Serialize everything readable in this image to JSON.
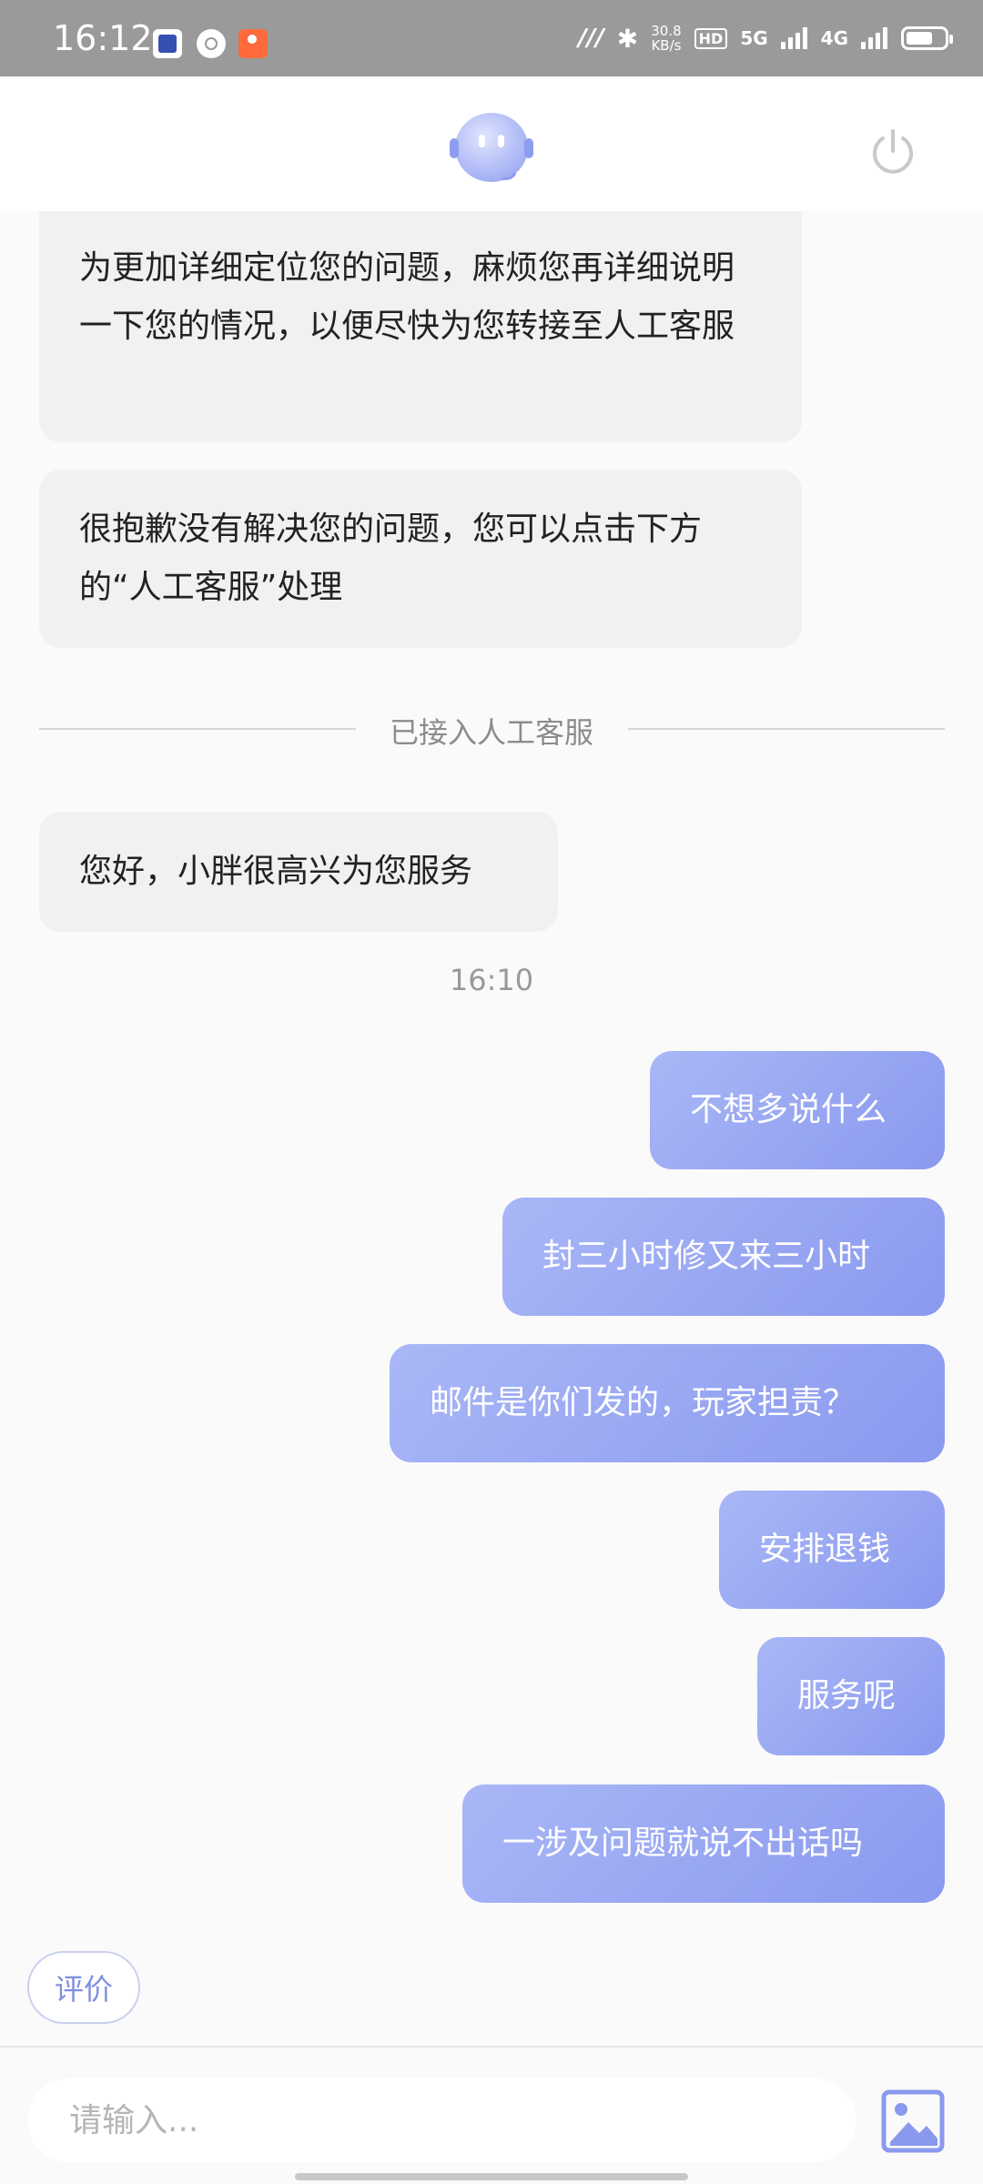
{
  "status_bar": {
    "time": "16:12",
    "speed_value": "30.8",
    "speed_unit": "KB/s",
    "hd": "HD",
    "net1": "5G",
    "net2": "4G"
  },
  "colors": {
    "bubble_out_start": "#a9b7f7",
    "bubble_out_end": "#8a99ee",
    "accent": "#7f8fe0"
  },
  "messages_in": [
    {
      "text": "为更加详细定位您的问题，麻烦您再详细说明一下您的情况，以便尽快为您转接至人工客服"
    },
    {
      "text": "很抱歉没有解决您的问题，您可以点击下方的“人工客服”处理"
    },
    {
      "text": "您好，小胖很高兴为您服务"
    }
  ],
  "divider": {
    "text": "已接入人工客服"
  },
  "timestamp": "16:10",
  "messages_out": [
    {
      "text": "不想多说什么"
    },
    {
      "text": "封三小时修又来三小时"
    },
    {
      "text": "邮件是你们发的，玩家担责？"
    },
    {
      "text": "安排退钱"
    },
    {
      "text": "服务呢"
    },
    {
      "text": "一涉及问题就说不出话吗"
    }
  ],
  "rate_button": {
    "label": "评价"
  },
  "input": {
    "placeholder": "请输入..."
  },
  "icons": {
    "header_avatar": "robot-avatar-icon",
    "header_power": "power-icon",
    "image_upload": "image-icon"
  }
}
